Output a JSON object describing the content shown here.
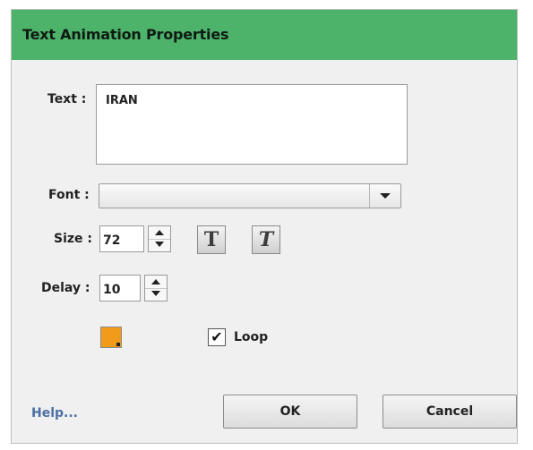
{
  "window": {
    "title": "Text Animation Properties"
  },
  "labels": {
    "text": "Text :",
    "font": "Font :",
    "size": "Size :",
    "delay": "Delay :"
  },
  "fields": {
    "text_value": "IRAN",
    "font_value": "",
    "size_value": "72",
    "delay_value": "10"
  },
  "style_buttons": {
    "bold": "T",
    "italic": "T"
  },
  "color": {
    "swatch": "#f29a19"
  },
  "loop": {
    "label": "Loop",
    "checked": true,
    "mark": "✔"
  },
  "footer": {
    "help": "Help...",
    "ok": "OK",
    "cancel": "Cancel"
  },
  "accents": {
    "titlebar": "#4db36b",
    "help_link": "#4d6fa3"
  },
  "icons": [
    "dropdown-arrow-icon",
    "spin-up-icon",
    "spin-down-icon",
    "bold-icon",
    "italic-icon",
    "checkmark-icon",
    "color-swatch-icon"
  ]
}
